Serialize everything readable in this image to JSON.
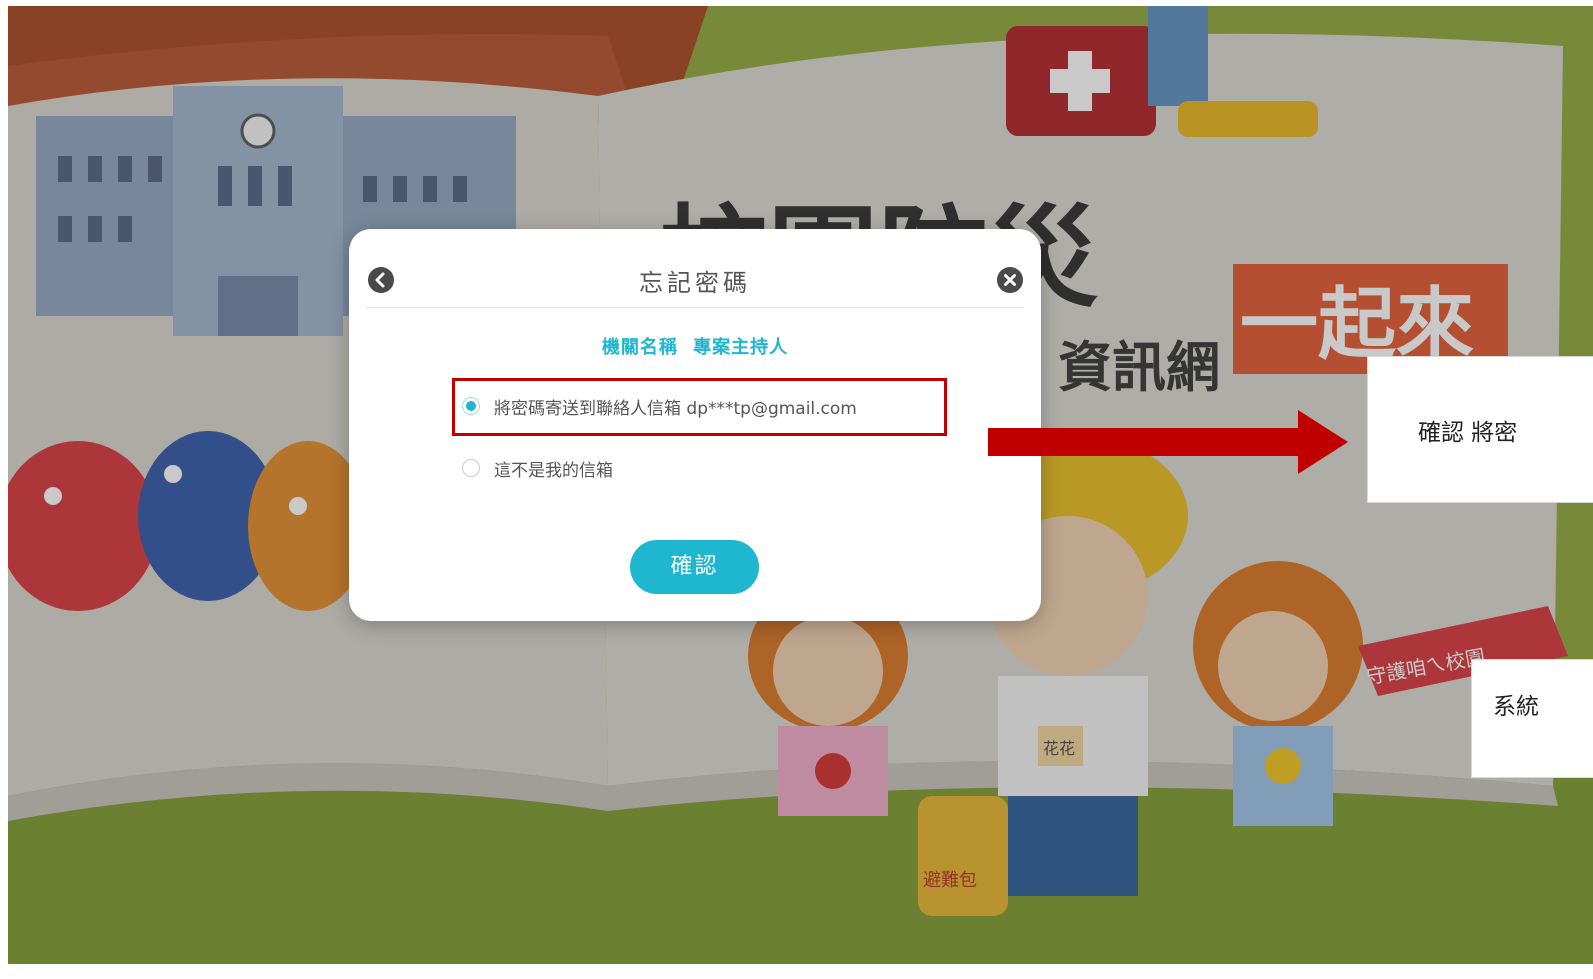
{
  "hero": {
    "school_label": "校園防災",
    "together_label": "一起來",
    "site_label_visible": "資訊網",
    "flag_label": "守護咱ㄟ校園",
    "badge_label": "花花",
    "bag_label": "避難包"
  },
  "modal": {
    "title": "忘記密碼",
    "org_name": "機關名稱",
    "org_host": "專案主持人",
    "option_send_email": "將密碼寄送到聯絡人信箱 dp***tp@gmail.com",
    "option_not_my_email": "這不是我的信箱",
    "selected_option": "option_send_email",
    "confirm_label": "確認"
  },
  "annotations": {
    "note1_text": "確認 將密",
    "note2_text": "系統",
    "highlight_color": "#c00000",
    "arrow_color": "#c00000"
  },
  "colors": {
    "accent": "#1fb6cf",
    "modal_bg": "#ffffff",
    "icon_dark": "#4a4a4a"
  }
}
